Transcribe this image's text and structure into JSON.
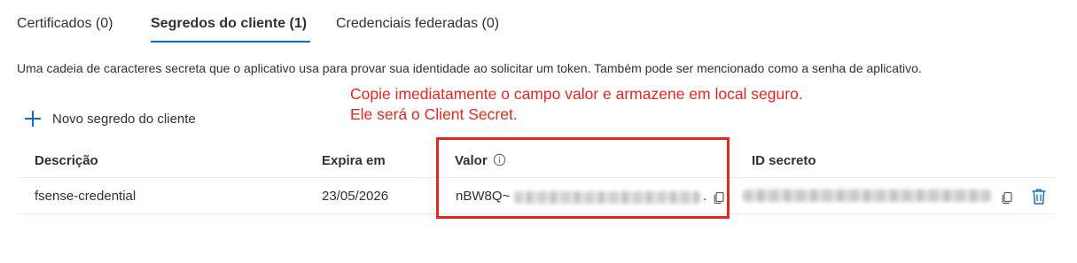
{
  "tabs": [
    {
      "label": "Certificados (0)"
    },
    {
      "label": "Segredos do cliente (1)"
    },
    {
      "label": "Credenciais federadas (0)"
    }
  ],
  "description": "Uma cadeia de caracteres secreta que o aplicativo usa para provar sua identidade ao solicitar um token. Também pode ser mencionado como a senha de aplicativo.",
  "annotation": {
    "line1": "Copie imediatamente o campo valor e armazene em local seguro.",
    "line2": "Ele será o Client Secret.",
    "color": "#e8261f"
  },
  "add_button": {
    "label": "Novo segredo do cliente",
    "icon": "plus-icon"
  },
  "table": {
    "headers": {
      "description": "Descrição",
      "expires": "Expira em",
      "value": "Valor",
      "secret_id": "ID secreto"
    },
    "rows": [
      {
        "description": "fsense-credential",
        "expires": "23/05/2026",
        "value_prefix": "nBW8Q~",
        "value_suffix": "."
      }
    ]
  },
  "icons": {
    "copy": "copy-icon",
    "delete": "trash-icon",
    "info": "info-icon"
  },
  "colors": {
    "accent": "#0f6cbd",
    "text": "#323130",
    "divider": "#edebe9"
  }
}
